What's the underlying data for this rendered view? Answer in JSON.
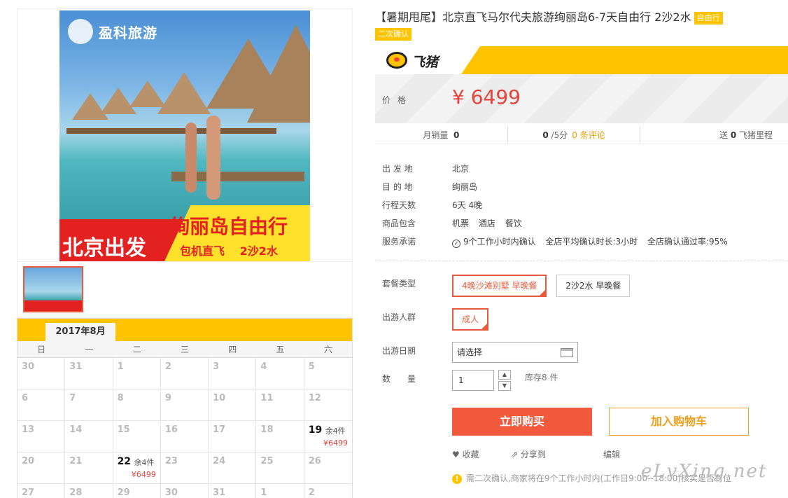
{
  "product_image": {
    "logo_text": "盈科旅游",
    "headline": "绚丽岛自由行",
    "origin": "北京出发",
    "subline": "包机直飞　 2沙2水"
  },
  "calendar": {
    "month": "2017年8月",
    "weekdays": [
      "日",
      "一",
      "二",
      "三",
      "四",
      "五",
      "六"
    ],
    "days": [
      {
        "d": "30"
      },
      {
        "d": "31"
      },
      {
        "d": "1"
      },
      {
        "d": "2"
      },
      {
        "d": "3"
      },
      {
        "d": "4"
      },
      {
        "d": "5"
      },
      {
        "d": "6"
      },
      {
        "d": "7"
      },
      {
        "d": "8"
      },
      {
        "d": "9"
      },
      {
        "d": "10"
      },
      {
        "d": "11"
      },
      {
        "d": "12"
      },
      {
        "d": "13"
      },
      {
        "d": "14"
      },
      {
        "d": "15"
      },
      {
        "d": "16"
      },
      {
        "d": "17"
      },
      {
        "d": "18"
      },
      {
        "d": "19",
        "stock": "余4件",
        "price": "¥6499"
      },
      {
        "d": "20"
      },
      {
        "d": "21"
      },
      {
        "d": "22",
        "stock": "余4件",
        "price": "¥6499"
      },
      {
        "d": "23"
      },
      {
        "d": "24"
      },
      {
        "d": "25"
      },
      {
        "d": "26"
      },
      {
        "d": "27"
      },
      {
        "d": "28"
      },
      {
        "d": "29"
      },
      {
        "d": "30"
      },
      {
        "d": "31"
      },
      {
        "d": "1"
      },
      {
        "d": "2"
      }
    ]
  },
  "product": {
    "title": "【暑期甩尾】北京直飞马尔代夫旅游绚丽岛6-7天自由行 2沙2水",
    "tag1": "自由行",
    "tag2": "二次确认",
    "brand": "飞猪",
    "price_label": "价格",
    "price": "¥ 6499",
    "monthly_sales_label": "月销量",
    "monthly_sales": "0",
    "rating": "0",
    "rating_suffix": "/5分",
    "reviews": "0 条评论",
    "miles_prefix": "送",
    "miles": "0",
    "miles_suffix": "飞猪里程"
  },
  "info": [
    {
      "k": "出 发 地",
      "v": "北京"
    },
    {
      "k": "目 的 地",
      "v": "绚丽岛"
    },
    {
      "k": "行程天数",
      "v": "6天 4晚"
    },
    {
      "k": "商品包含",
      "items": [
        "机票",
        "酒店",
        "餐饮"
      ]
    },
    {
      "k": "服务承诺",
      "items": [
        "9个工作小时内确认",
        "全店平均确认时长:3小时",
        "全店确认通过率:95%"
      ]
    }
  ],
  "options": {
    "package_label": "套餐类型",
    "packages": [
      "4晚沙滩别墅 早晚餐",
      "2沙2水 早晚餐"
    ],
    "traveler_label": "出游人群",
    "travelers": [
      "成人"
    ],
    "date_label": "出游日期",
    "date_placeholder": "请选择",
    "qty_label": "数　　量",
    "qty": "1",
    "stock": "库存8 件"
  },
  "buttons": {
    "buy": "立即购买",
    "cart": "加入购物车",
    "favorite": "收藏",
    "share": "分享到",
    "edit": "编辑"
  },
  "notice": "需二次确认,商家将在9个工作小时内(工作日9:00--18:00)核实是否有位",
  "watermark": "eLvXing.net",
  "colors": {
    "accent": "#ffc300",
    "price": "#e8433a",
    "buy": "#f15a3c"
  }
}
